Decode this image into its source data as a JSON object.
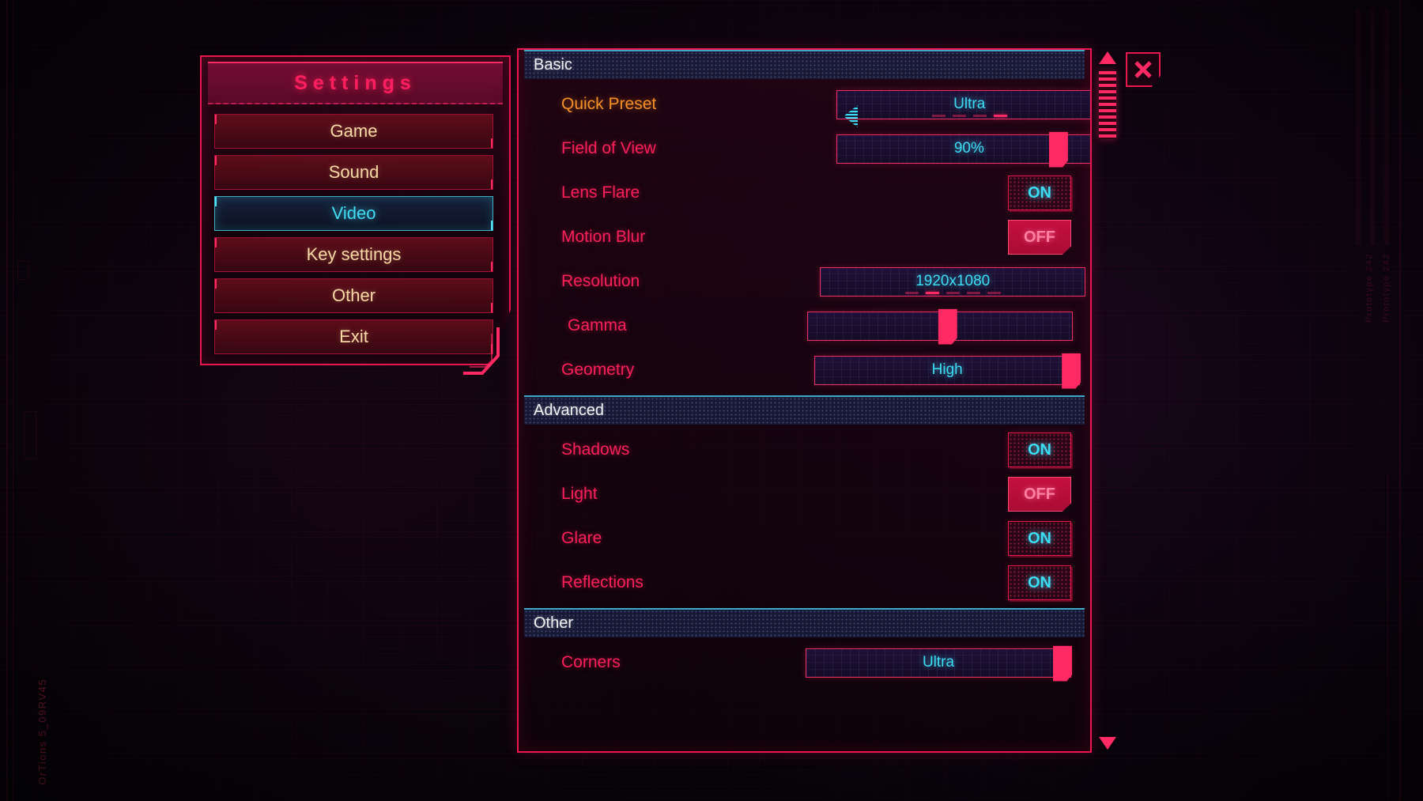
{
  "sidebar": {
    "title": "Settings",
    "items": [
      {
        "label": "Game",
        "active": false
      },
      {
        "label": "Sound",
        "active": false
      },
      {
        "label": "Video",
        "active": true
      },
      {
        "label": "Key settings",
        "active": false
      },
      {
        "label": "Other",
        "active": false
      },
      {
        "label": "Exit",
        "active": false
      }
    ]
  },
  "panel": {
    "sections": [
      {
        "title": "Basic",
        "rows": [
          {
            "label": "Quick Preset",
            "type": "selector",
            "value": "Ultra",
            "dashes": 4,
            "active_dash": 3,
            "label_accent": true
          },
          {
            "label": "Field of View",
            "type": "slider",
            "value": "90%",
            "percent": 86
          },
          {
            "label": "Lens Flare",
            "type": "toggle",
            "value": "ON"
          },
          {
            "label": "Motion Blur",
            "type": "toggle",
            "value": "OFF"
          },
          {
            "label": "Resolution",
            "type": "selector_plain",
            "value": "1920x1080",
            "dashes": 5,
            "active_dash": 1
          },
          {
            "label": "Gamma",
            "type": "slider",
            "value": "",
            "percent": 53,
            "indent": true
          },
          {
            "label": "Geometry",
            "type": "slider",
            "value": "High",
            "percent": 100
          }
        ]
      },
      {
        "title": "Advanced",
        "rows": [
          {
            "label": "Shadows",
            "type": "toggle",
            "value": "ON"
          },
          {
            "label": "Light",
            "type": "toggle",
            "value": "OFF"
          },
          {
            "label": "Glare",
            "type": "toggle",
            "value": "ON"
          },
          {
            "label": "Reflections",
            "type": "toggle",
            "value": "ON"
          }
        ]
      },
      {
        "title": "Other",
        "rows": [
          {
            "label": "Corners",
            "type": "slider",
            "value": "Ultra",
            "percent": 100
          }
        ]
      }
    ]
  },
  "scrollbar": {
    "up_icon": "triangle-up-icon",
    "down_icon": "triangle-down-icon",
    "thumb_position_percent": 3
  },
  "close_button": {
    "icon": "close-x-icon",
    "label": ""
  },
  "background": {
    "left_code": "OrTions 5_09RV45",
    "right_codes": [
      "Prototype 242",
      "Prototype 242"
    ]
  },
  "colors": {
    "accent_pink": "#ff2a63",
    "accent_cyan": "#3ddcf5",
    "accent_amber": "#f59026",
    "frame_red": "#ef1550",
    "menu_text": "#f7d9a4",
    "off_fill": "#c6103f"
  }
}
